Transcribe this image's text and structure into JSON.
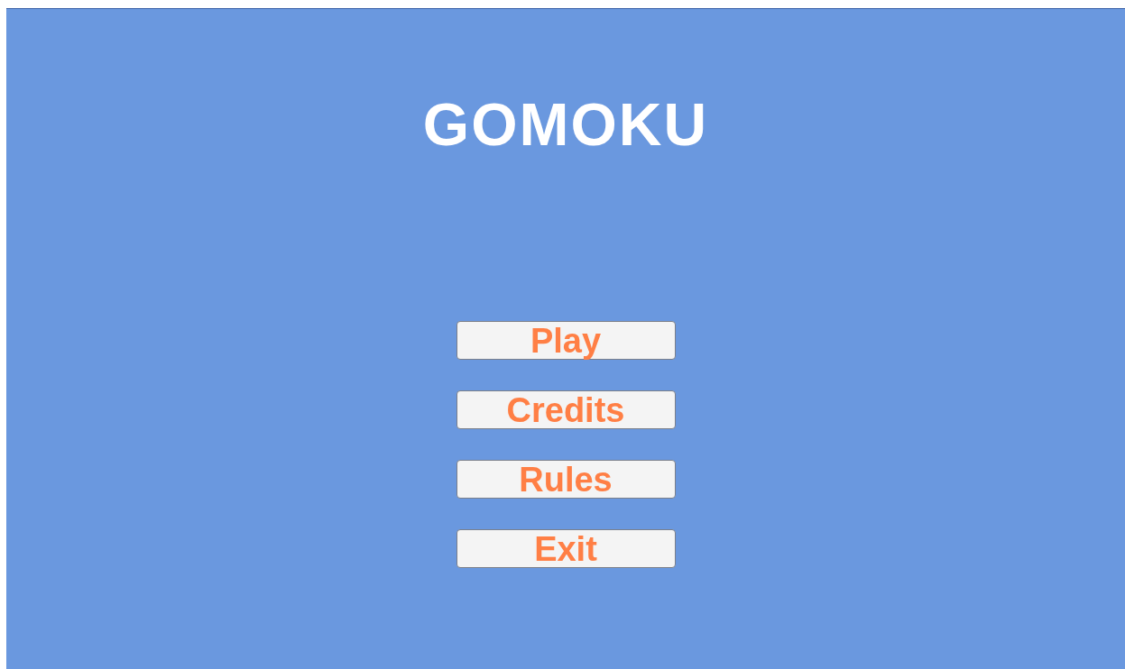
{
  "title": "GOMOKU",
  "buttons": [
    {
      "label": "Play"
    },
    {
      "label": "Credits"
    },
    {
      "label": "Rules"
    },
    {
      "label": "Exit"
    }
  ]
}
